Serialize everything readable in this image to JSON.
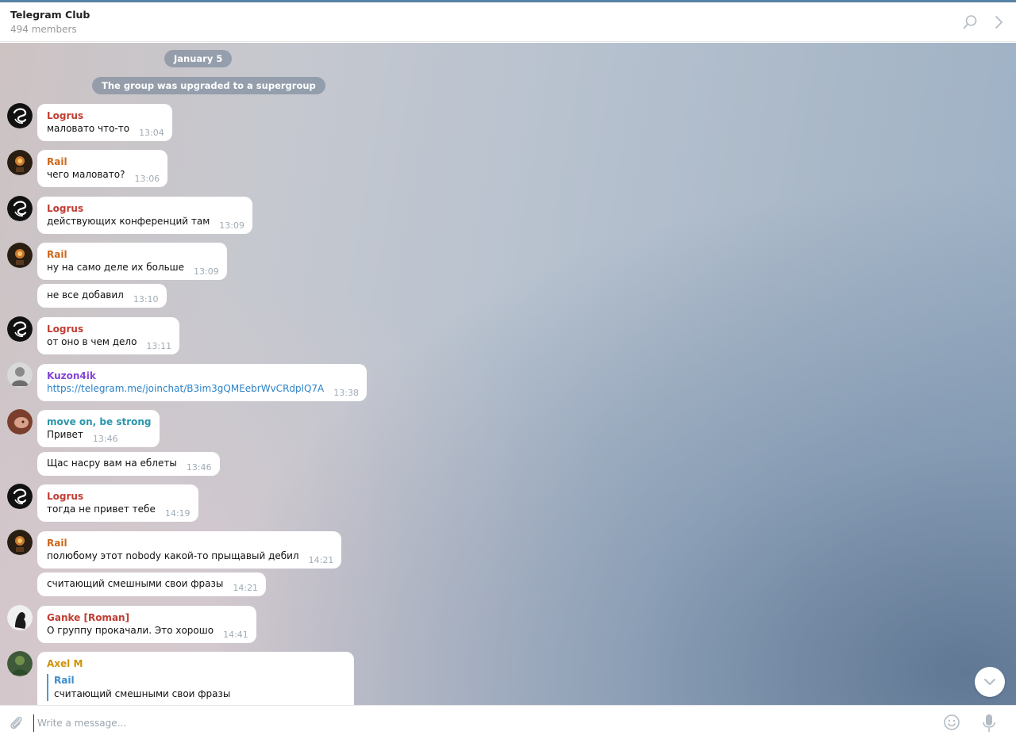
{
  "header": {
    "title": "Telegram Club",
    "subtitle": "494 members"
  },
  "service": {
    "date": "January 5",
    "event": "The group was upgraded to a supergroup"
  },
  "messages": [
    {
      "name": "Logrus",
      "name_color": "#c03d33",
      "text": "маловато что-то",
      "time": "13:04"
    },
    {
      "name": "Rail",
      "name_color": "#ce671b",
      "text": "чего маловато?",
      "time": "13:06"
    },
    {
      "name": "Logrus",
      "name_color": "#c03d33",
      "text": "действующих конференций там",
      "time": "13:09"
    },
    {
      "name": "Rail",
      "name_color": "#ce671b",
      "text": "ну на само деле их больше",
      "time": "13:09"
    },
    {
      "name": "",
      "name_color": "",
      "text": "не все добавил",
      "time": "13:10"
    },
    {
      "name": "Logrus",
      "name_color": "#c03d33",
      "text": "от оно в чем дело",
      "time": "13:11"
    },
    {
      "name": "Kuzon4ik",
      "name_color": "#8544d6",
      "text": "https://telegram.me/joinchat/B3im3gQMEebrWvCRdplQ7A",
      "time": "13:38"
    },
    {
      "name": "move on, be strong",
      "name_color": "#2996ad",
      "text": "Привет",
      "time": "13:46"
    },
    {
      "name": "",
      "name_color": "",
      "text": "Щас насру вам на еблеты",
      "time": "13:46"
    },
    {
      "name": "Logrus",
      "name_color": "#c03d33",
      "text": "тогда не привет тебе",
      "time": "14:19"
    },
    {
      "name": "Rail",
      "name_color": "#ce671b",
      "text": "полюбому этот nobody какой-то прыщавый дебил",
      "time": "14:21"
    },
    {
      "name": "",
      "name_color": "",
      "text": "считающий смешными свои фразы",
      "time": "14:21"
    },
    {
      "name": "Ganke [Roman]",
      "name_color": "#c03d33",
      "text": "О группу прокачали. Это хорошо",
      "time": "14:41"
    },
    {
      "name": "Axel M",
      "name_color": "#d09306",
      "reply_name": "Rail",
      "reply_text": "считающий смешными свои фразы"
    }
  ],
  "composer": {
    "placeholder": "Write a message..."
  },
  "icons": {
    "search": "search-icon",
    "more": "chevron-right-icon",
    "attach": "paperclip-icon",
    "emoji": "smile-icon",
    "mic": "microphone-icon",
    "scroll": "chevron-down-icon"
  }
}
